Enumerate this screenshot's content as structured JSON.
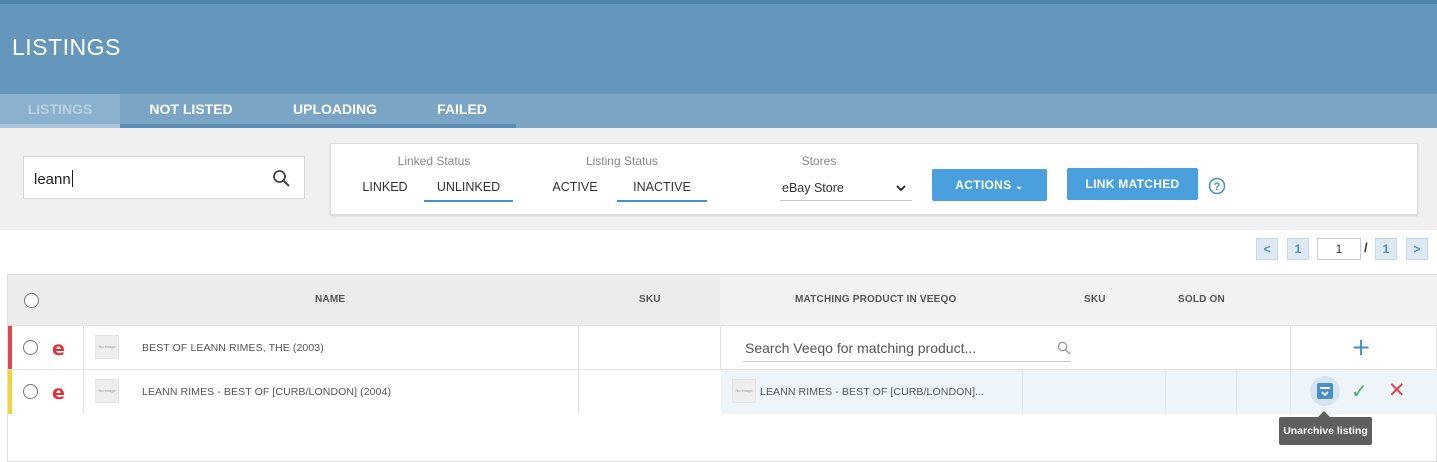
{
  "header": {
    "title": "LISTINGS"
  },
  "tabs": [
    {
      "label": "LISTINGS",
      "active": true
    },
    {
      "label": "NOT LISTED",
      "active": false
    },
    {
      "label": "UPLOADING",
      "active": false
    },
    {
      "label": "FAILED",
      "active": false
    }
  ],
  "search": {
    "value": "leann",
    "icon": "search-icon"
  },
  "filters": {
    "linked_status": {
      "title": "Linked Status",
      "options": [
        "LINKED",
        "UNLINKED"
      ],
      "selected": "UNLINKED"
    },
    "listing_status": {
      "title": "Listing Status",
      "options": [
        "ACTIVE",
        "INACTIVE"
      ],
      "selected": "INACTIVE"
    },
    "stores": {
      "title": "Stores",
      "selected": "eBay Store"
    }
  },
  "buttons": {
    "actions": "ACTIONS",
    "actions_caret": "⌄",
    "link_matched": "LINK MATCHED",
    "help": "?"
  },
  "pagination": {
    "prev": "<",
    "first": "1",
    "current": "1",
    "separator": "/",
    "last": "1",
    "next": ">"
  },
  "table": {
    "headers": {
      "name": "NAME",
      "sku": "SKU",
      "matching": "MATCHING PRODUCT IN VEEQO",
      "sku2": "SKU",
      "sold_on": "SOLD ON"
    },
    "rows": [
      {
        "marker_color": "#e0454b",
        "channel_icon": "e",
        "thumb": "No image",
        "name": "BEST OF LEANN RIMES, THE (2003)",
        "match_placeholder": "Search Veeqo for matching product...",
        "add_icon": "+"
      },
      {
        "marker_color": "#f2d43a",
        "channel_icon": "e",
        "thumb": "No image",
        "name": "LEANN RIMES - BEST OF [CURB/LONDON] (2004)",
        "match_thumb": "No image",
        "match_name": "LEANN RIMES - BEST OF [CURB/LONDON]...",
        "confirm_icon": "✓",
        "reject_icon": "✕"
      }
    ]
  },
  "tooltip": {
    "text": "Unarchive listing"
  },
  "colors": {
    "header": "#6497bb",
    "accent": "#4a9fdd",
    "ebay_blue": "#0064d2",
    "ebay_red": "#e53238",
    "ebay_yellow": "#f5af02",
    "ebay_green": "#86b817"
  }
}
